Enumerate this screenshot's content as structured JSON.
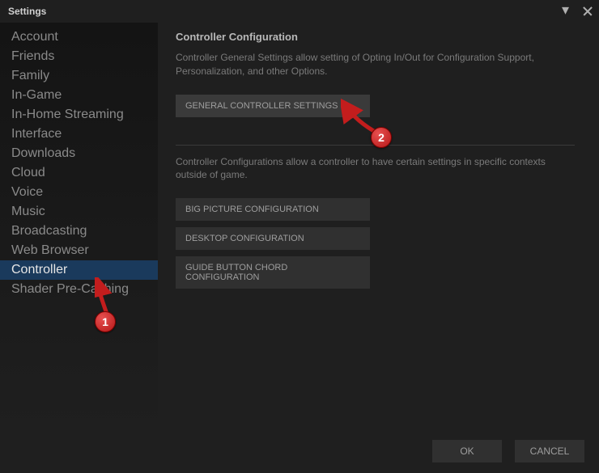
{
  "window": {
    "title": "Settings"
  },
  "sidebar": {
    "items": [
      {
        "label": "Account"
      },
      {
        "label": "Friends"
      },
      {
        "label": "Family"
      },
      {
        "label": "In-Game"
      },
      {
        "label": "In-Home Streaming"
      },
      {
        "label": "Interface"
      },
      {
        "label": "Downloads"
      },
      {
        "label": "Cloud"
      },
      {
        "label": "Voice"
      },
      {
        "label": "Music"
      },
      {
        "label": "Broadcasting"
      },
      {
        "label": "Web Browser"
      },
      {
        "label": "Controller"
      },
      {
        "label": "Shader Pre-Caching"
      }
    ],
    "selected_index": 12
  },
  "content": {
    "heading": "Controller Configuration",
    "desc1": "Controller General Settings allow setting of Opting In/Out for Configuration Support, Personalization, and other Options.",
    "general_btn": "GENERAL CONTROLLER SETTINGS",
    "desc2": "Controller Configurations allow a controller to have certain settings in specific contexts outside of game.",
    "big_picture_btn": "BIG PICTURE CONFIGURATION",
    "desktop_btn": "DESKTOP CONFIGURATION",
    "guide_btn": "GUIDE BUTTON CHORD CONFIGURATION"
  },
  "footer": {
    "ok": "OK",
    "cancel": "CANCEL"
  },
  "annotations": {
    "one": "1",
    "two": "2"
  },
  "colors": {
    "accent": "#1a3a5c",
    "badge": "#c31d1d"
  }
}
